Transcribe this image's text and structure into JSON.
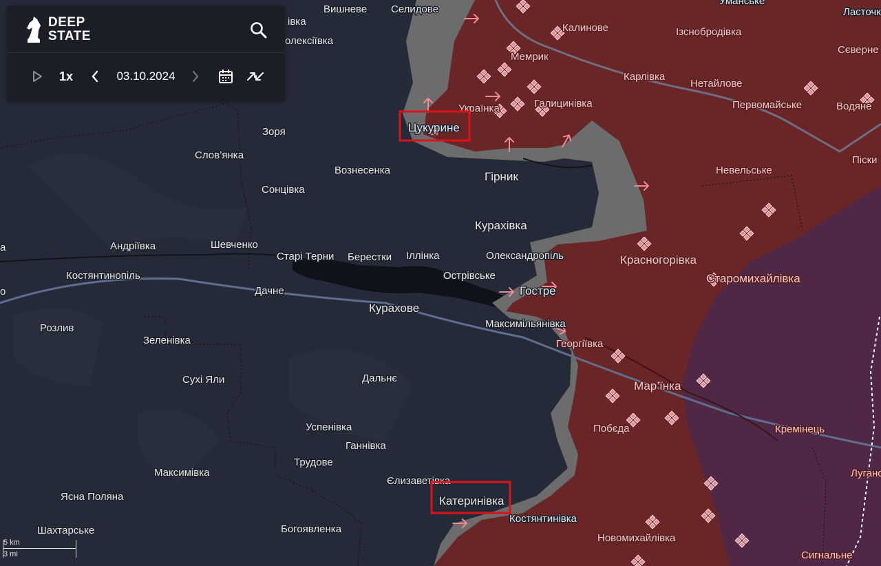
{
  "app": {
    "brand": "DEEP\nSTATE"
  },
  "toolbar": {
    "speed": "1x",
    "date": "03.10.2024"
  },
  "scale": {
    "km": "5 km",
    "mi": "3 mi"
  },
  "colors": {
    "occupied": "#6a2527",
    "contested": "#6c6c6c",
    "free": "#252a38",
    "crimea_zone": "#4f2848",
    "assault": "#f08a92",
    "highlight": "#e0101a"
  },
  "labels": {
    "vyshneve": "Вишневе",
    "selydove": "Селидове",
    "umanske": "Уманське",
    "lastochk": "Ласточк",
    "kalynove": "Калинове",
    "yasnobrodivka": "Ізснобродівка",
    "oleksiivka": "олексіївка",
    "viska": "івка",
    "memryk": "Мемрик",
    "siverne": "Сєверне",
    "karlivka": "Карлівка",
    "netailove": "Нетайлове",
    "pervomaiske": "Первомайське",
    "vodiane": "Водяне",
    "ukrainka": "Українка",
    "halytsynivka": "Галицинівка",
    "tsukuryne": "Цукурине",
    "zoria": "Зоря",
    "slovianka": "Слов’янка",
    "voznesenka": "Вознесенка",
    "hirnyk": "Гірник",
    "nevelske": "Невельське",
    "piski": "Піски",
    "sontsivka": "Сонцівка",
    "kurakhivka": "Курахівка",
    "andriivka": "Андріївка",
    "shevchenko": "Шевченко",
    "starterny": "Старі Терни",
    "berestky": "Берестки",
    "illinka": "Іллінка",
    "oleksandropil": "Олександропіль",
    "krasnohorivka": "Красногорівка",
    "kostiantynopil": "Костянтинопіль",
    "ostrivske": "Острівське",
    "staromykhailivka": "Старомихайлівка",
    "dachne": "Дачне",
    "hostre": "Гостре",
    "kurakhove": "Курахове",
    "maksymilianivka": "Максимільянівка",
    "rozlyv": "Розлив",
    "heorhiivka": "Георгіївка",
    "zelenivka": "Зеленівка",
    "marinka": "Мар’їнка",
    "dalne": "Дальнє",
    "sukhi_yaly": "Сухі Яли",
    "uspenivka": "Успенівка",
    "pobieda": "Побєда",
    "kreminets": "Кремінець",
    "hannivka": "Ганнівка",
    "trudove": "Трудове",
    "maksymivka": "Максимівка",
    "yelyzavetivka": "Єлизаветівка",
    "luhanske": "Луганс",
    "kateryniivka": "Катеринівка",
    "yasna_poliana": "Ясна Поляна",
    "kostiantynivka": "Костянтинівка",
    "shakhtarske": "Шахтарське",
    "bohoiavlenka": "Богоявленка",
    "novomykhailivka": "Новомихайлівка",
    "syhnalne": "Сигнальне",
    "edge_a": "а",
    "edge_o": "о"
  }
}
